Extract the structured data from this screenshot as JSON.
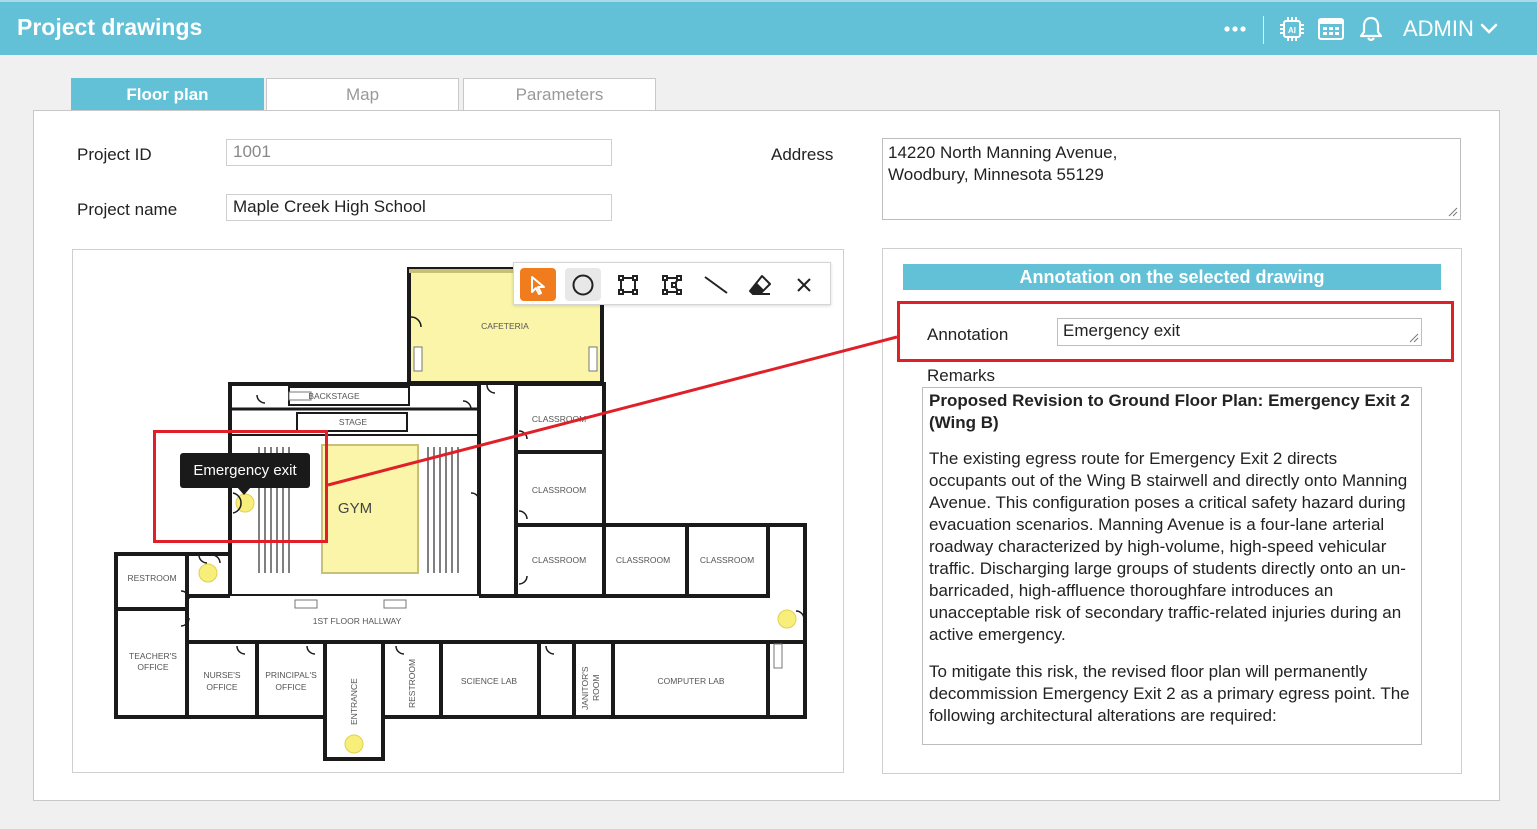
{
  "header": {
    "title": "Project drawings",
    "user_label": "ADMIN"
  },
  "icons": [
    "more-icon",
    "ai-chip-icon",
    "calendar-card-icon",
    "bell-icon",
    "chevron-down-icon"
  ],
  "tabs": [
    {
      "label": "Floor plan",
      "active": true
    },
    {
      "label": "Map",
      "active": false
    },
    {
      "label": "Parameters",
      "active": false
    }
  ],
  "form": {
    "project_id_label": "Project ID",
    "project_id_value": "1001",
    "project_name_label": "Project name",
    "project_name_value": "Maple Creek High School",
    "address_label": "Address",
    "address_line1": "14220 North Manning Avenue,",
    "address_line2": "Woodbury, Minnesota 55129"
  },
  "drawing_tools": [
    "select-tool",
    "circle-tool",
    "rectangle-tool",
    "polygon-tool",
    "line-tool",
    "eraser-tool",
    "close-tool"
  ],
  "floorplan": {
    "tooltip": "Emergency exit",
    "rooms": {
      "cafeteria": "CAFETERIA",
      "backstage": "BACKSTAGE",
      "stage": "STAGE",
      "gym": "GYM",
      "classroom": "CLASSROOM",
      "restroom": "RESTROOM",
      "teachers_office_1": "TEACHER'S",
      "teachers_office_2": "OFFICE",
      "nurses_office_1": "NURSE'S",
      "nurses_office_2": "OFFICE",
      "principals_office_1": "PRINCIPAL'S",
      "principals_office_2": "OFFICE",
      "entrance": "ENTRANCE",
      "science_lab": "SCIENCE LAB",
      "janitors_room_1": "JANITOR'S",
      "janitors_room_2": "ROOM",
      "computer_lab": "COMPUTER LAB",
      "hallway": "1ST FLOOR HALLWAY"
    }
  },
  "annotation_panel": {
    "heading": "Annotation on the selected drawing",
    "annotation_label": "Annotation",
    "annotation_value": "Emergency exit",
    "remarks_label": "Remarks",
    "remarks_title": "Proposed Revision to Ground Floor Plan: Emergency Exit 2 (Wing B)",
    "remarks_p1": "The existing egress route for Emergency Exit 2 directs occupants out of the Wing B stairwell and directly onto Manning Avenue. This configuration poses a critical safety hazard during evacuation scenarios. Manning Avenue is a four-lane arterial roadway characterized by high-volume, high-speed vehicular traffic. Discharging large groups of students directly onto an un-barricaded, high-affluence thoroughfare introduces an unacceptable risk of secondary traffic-related injuries during an active emergency.",
    "remarks_p2": "To mitigate this risk, the revised floor plan will permanently decommission Emergency Exit 2 as a primary egress point. The following architectural alterations are required:"
  },
  "colors": {
    "accent": "#62c1d7",
    "tool_active": "#f07c1e",
    "highlight": "#e02028",
    "room_fill": "#faf5a8"
  }
}
